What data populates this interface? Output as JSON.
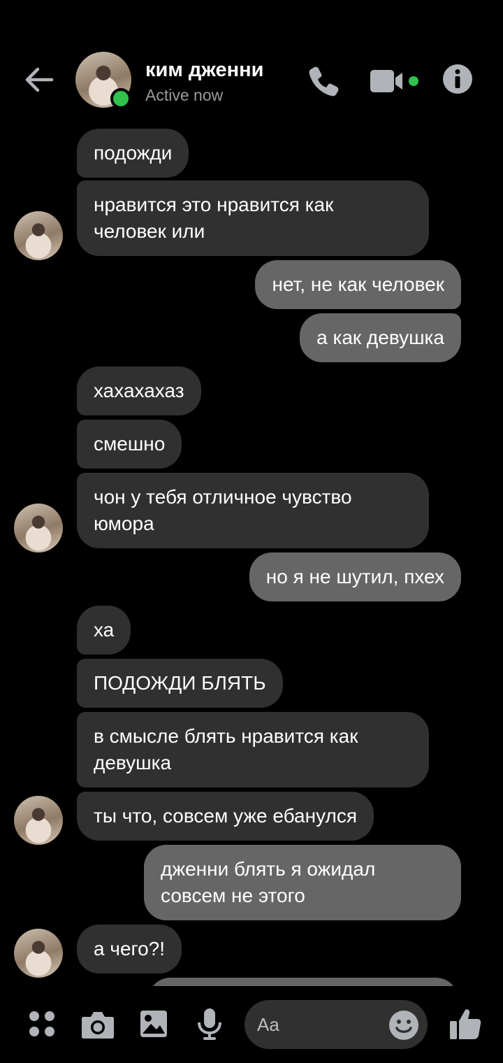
{
  "header": {
    "contact_name": "ким дженни",
    "status": "Active now"
  },
  "messages": [
    {
      "side": "received",
      "text": "подожди"
    },
    {
      "side": "received",
      "text": "нравится это нравится как\nчеловек или"
    },
    {
      "side": "sent",
      "text": "нет, не как человек"
    },
    {
      "side": "sent",
      "text": "а как девушка"
    },
    {
      "side": "received",
      "text": "хахахахаз"
    },
    {
      "side": "received",
      "text": "смешно"
    },
    {
      "side": "received",
      "text": "чон у тебя отличное чувство\nюмора"
    },
    {
      "side": "sent",
      "text": "но я не шутил, пхех"
    },
    {
      "side": "received",
      "text": "ха"
    },
    {
      "side": "received",
      "text": "ПОДОЖДИ БЛЯТЬ"
    },
    {
      "side": "received",
      "text": "в смысле блять нравится как\nдевушка"
    },
    {
      "side": "received",
      "text": "ты что, совсем уже ебанулся"
    },
    {
      "side": "sent",
      "text": "дженни блять я ожидал\nсовсем не этого"
    },
    {
      "side": "received",
      "text": "а чего?!"
    }
  ],
  "composer": {
    "placeholder": "Aa"
  },
  "colors": {
    "online": "#31c24d",
    "received_bubble": "#303030",
    "sent_bubble": "#666666",
    "icon": "#b0b3b8"
  },
  "icons": {
    "back": "arrow-left-icon",
    "call": "phone-icon",
    "video": "video-camera-icon",
    "info": "info-icon",
    "menu": "four-dots-icon",
    "camera": "camera-icon",
    "gallery": "image-icon",
    "mic": "microphone-icon",
    "emoji": "emoji-icon",
    "like": "thumbs-up-icon"
  }
}
